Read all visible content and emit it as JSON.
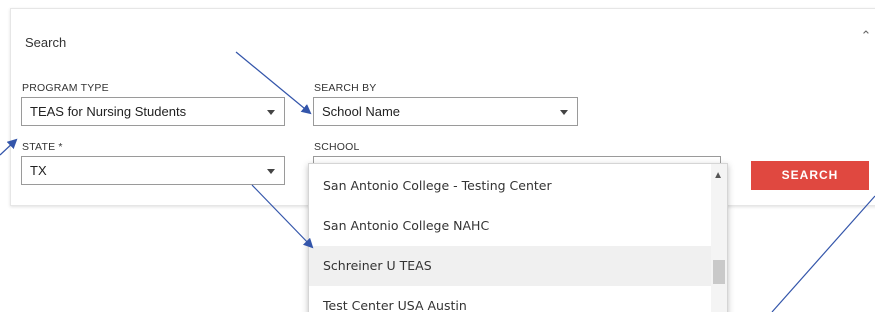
{
  "panel": {
    "title": "Search",
    "collapse_icon": "chevron-up-icon"
  },
  "program_type": {
    "label": "PROGRAM TYPE",
    "value": "TEAS for Nursing Students"
  },
  "search_by": {
    "label": "SEARCH BY",
    "value": "School Name"
  },
  "state": {
    "label": "STATE *",
    "value": "TX"
  },
  "school": {
    "label": "SCHOOL",
    "options": [
      "San Antonio College - Testing Center",
      "San Antonio College NAHC",
      "Schreiner U TEAS",
      "Test Center USA Austin"
    ],
    "highlighted_index": 2
  },
  "search_button": {
    "label": "SEARCH",
    "color": "#e04840"
  },
  "annotation_color": "#3355aa"
}
